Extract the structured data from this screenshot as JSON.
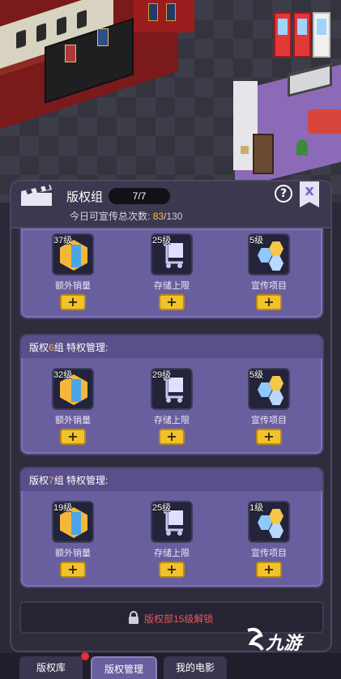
{
  "header": {
    "title": "版权组",
    "slots": "7/7",
    "daily_label": "今日可宣传总次数:",
    "daily_used": "83",
    "daily_total": "/130"
  },
  "groups": [
    {
      "skills": [
        {
          "level": "37级",
          "name": "额外销量",
          "plus": "+"
        },
        {
          "level": "25级",
          "name": "存储上限",
          "plus": "+"
        },
        {
          "level": "5级",
          "name": "宣传项目",
          "plus": "+"
        }
      ]
    },
    {
      "title_prefix": "版权",
      "title_num": "6",
      "title_suffix": "组 特权管理:",
      "skills": [
        {
          "level": "32级",
          "name": "额外销量",
          "plus": "+"
        },
        {
          "level": "29级",
          "name": "存储上限",
          "plus": "+"
        },
        {
          "level": "5级",
          "name": "宣传项目",
          "plus": "+"
        }
      ]
    },
    {
      "title_prefix": "版权",
      "title_num": "7",
      "title_suffix": "组 特权管理:",
      "skills": [
        {
          "level": "19级",
          "name": "额外销量",
          "plus": "+"
        },
        {
          "level": "25级",
          "name": "存储上限",
          "plus": "+"
        },
        {
          "level": "1级",
          "name": "宣传项目",
          "plus": "+"
        }
      ]
    }
  ],
  "lock": {
    "text": "版权部15级解锁"
  },
  "tabs": [
    "版权库",
    "版权管理",
    "我的电影"
  ],
  "watermark": "九游",
  "icons": {
    "help": "?",
    "close": "x"
  },
  "colors": {
    "accent_yellow": "#f2c22c",
    "highlight_orange": "#f2a93a",
    "lock_red": "#e05a5a",
    "card_purple": "#6a5f9e"
  }
}
